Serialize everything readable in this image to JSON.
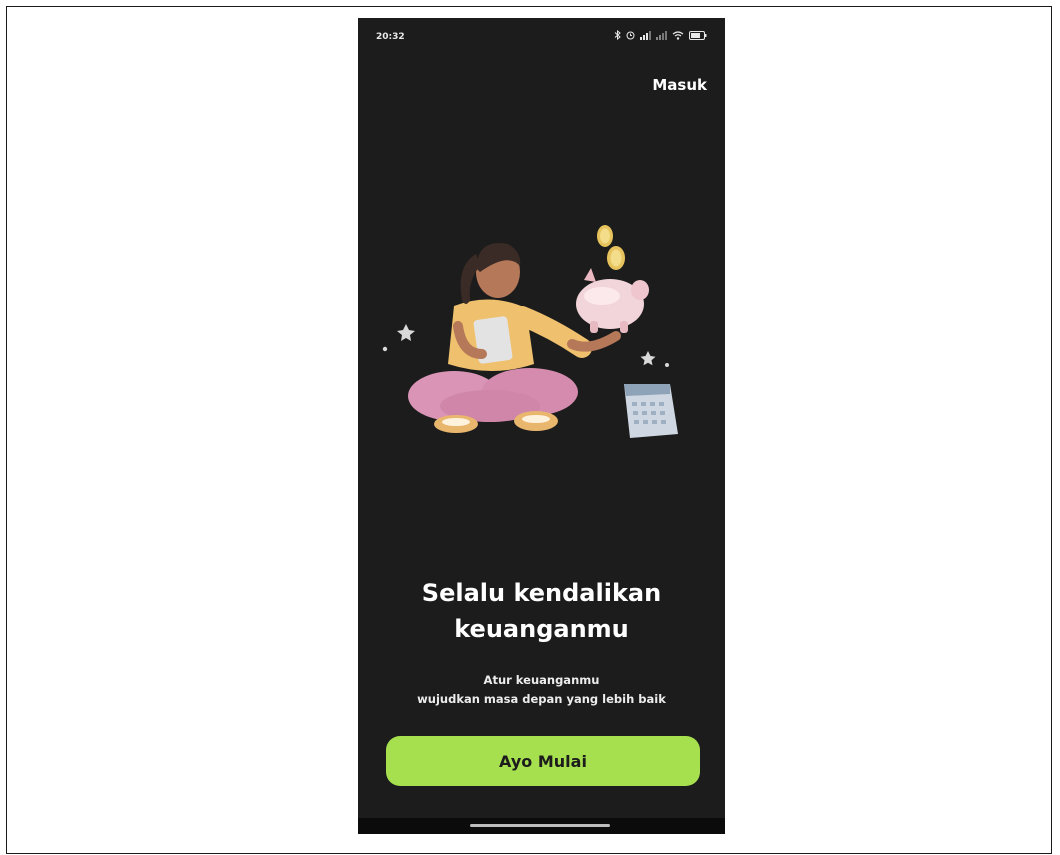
{
  "status_bar": {
    "time": "20:32",
    "icons": [
      "bluetooth-icon",
      "alarm-icon",
      "signal-icon",
      "signal-icon",
      "wifi-icon",
      "battery-icon"
    ]
  },
  "header": {
    "login_label": "Masuk"
  },
  "hero": {
    "title_line1": "Selalu kendalikan",
    "title_line2": "keuanganmu",
    "subtitle_line1": "Atur keuanganmu",
    "subtitle_line2": "wujudkan masa depan yang lebih baik"
  },
  "cta": {
    "label": "Ayo Mulai"
  },
  "colors": {
    "background": "#1c1c1c",
    "accent": "#a6e04f",
    "text": "#ffffff"
  }
}
